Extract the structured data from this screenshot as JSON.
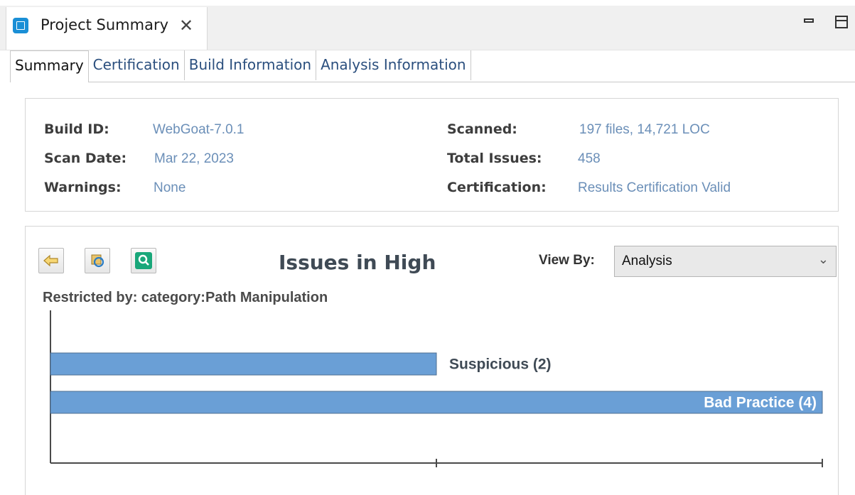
{
  "view": {
    "tab_title": "Project Summary",
    "close_glyph": "✕"
  },
  "subtabs": [
    {
      "label": "Summary",
      "active": true
    },
    {
      "label": "Certification",
      "active": false
    },
    {
      "label": "Build Information",
      "active": false
    },
    {
      "label": "Analysis Information",
      "active": false
    }
  ],
  "info": {
    "build_id_label": "Build ID:",
    "build_id": "WebGoat-7.0.1",
    "scan_date_label": "Scan Date:",
    "scan_date": "Mar 22, 2023",
    "warnings_label": "Warnings:",
    "warnings": "None",
    "scanned_label": "Scanned:",
    "scanned": "197 files, 14,721 LOC",
    "total_issues_label": "Total Issues:",
    "total_issues": "458",
    "certification_label": "Certification:",
    "certification": "Results Certification Valid"
  },
  "chart_toolbar": {
    "back_icon": "back-arrow-icon",
    "refresh_icon": "refresh-icon",
    "zoom_icon": "search-icon"
  },
  "chart_header": {
    "title": "Issues in High",
    "view_by_label": "View By:",
    "view_by_value": "Analysis",
    "restricted": "Restricted by: category:Path Manipulation"
  },
  "colors": {
    "bar_fill": "#6a9fd6",
    "bar_stroke": "#4f6f92",
    "label_dark": "#3f4a55",
    "label_light": "#ffffff"
  },
  "chart_data": {
    "type": "bar",
    "orientation": "horizontal",
    "categories": [
      "Suspicious (2)",
      "Bad Practice (4)"
    ],
    "values": [
      2,
      4
    ],
    "xlim": [
      0,
      4
    ],
    "title": "Issues in High",
    "grid": false
  }
}
